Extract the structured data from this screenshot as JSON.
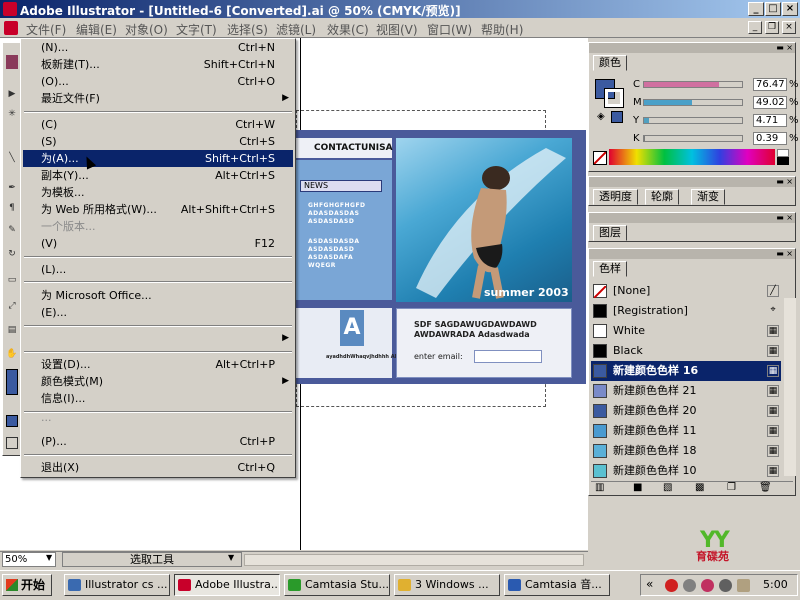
{
  "window": {
    "title": "Adobe Illustrator - [Untitled-6 [Converted].ai @ 50% (CMYK/预览)]",
    "controls": {
      "minimize": "_",
      "maximize": "□",
      "close": "×"
    }
  },
  "menubar": {
    "items": [
      "文件(F)",
      "编辑(E)",
      "对象(O)",
      "文字(T)",
      "选择(S)",
      "滤镜(L)",
      "效果(C)",
      "视图(V)",
      "窗口(W)",
      "帮助(H)"
    ],
    "doc_controls": {
      "minimize": "_",
      "restore": "❐",
      "close": "×"
    }
  },
  "file_menu": {
    "items": [
      {
        "label": "(N)...",
        "shortcut": "Ctrl+N"
      },
      {
        "label": "板新建(T)...",
        "shortcut": "Shift+Ctrl+N"
      },
      {
        "label": "(O)...",
        "shortcut": "Ctrl+O"
      },
      {
        "label": "最近文件(F)",
        "shortcut": "",
        "submenu": "▶"
      },
      {
        "label": "(C)",
        "shortcut": "Ctrl+W"
      },
      {
        "label": "(S)",
        "shortcut": "Ctrl+S"
      },
      {
        "label": "为(A)...",
        "shortcut": "Shift+Ctrl+S"
      },
      {
        "label": "副本(Y)...",
        "shortcut": "Alt+Ctrl+S"
      },
      {
        "label": "为模板...",
        "shortcut": ""
      },
      {
        "label": "为 Web 所用格式(W)...",
        "shortcut": "Alt+Shift+Ctrl+S"
      },
      {
        "label": "一个版本...",
        "shortcut": ""
      },
      {
        "label": "(V)",
        "shortcut": "F12"
      },
      {
        "label": "(L)...",
        "shortcut": ""
      },
      {
        "label": "为 Microsoft Office...",
        "shortcut": ""
      },
      {
        "label": "(E)...",
        "shortcut": ""
      },
      {
        "label": "",
        "shortcut": "",
        "submenu": "▶"
      },
      {
        "label": "设置(D)...",
        "shortcut": "Alt+Ctrl+P"
      },
      {
        "label": "颜色模式(M)",
        "shortcut": "",
        "submenu": "▶"
      },
      {
        "label": "信息(I)...",
        "shortcut": ""
      },
      {
        "label": "...",
        "shortcut": ""
      },
      {
        "label": "(P)...",
        "shortcut": "Ctrl+P"
      },
      {
        "label": "退出(X)",
        "shortcut": "Ctrl+Q"
      }
    ]
  },
  "artwork": {
    "contact": "CONTACTUNISA",
    "news": "NEWS",
    "text_block_1": [
      "GHFGHGFHGFD",
      "ADASDASDAS",
      "ASDASDASD"
    ],
    "text_block_2": [
      "ASDASDASDA",
      "ASDASDASD",
      "ASDASDAFA",
      "WQEGR"
    ],
    "summer": "summer 2003",
    "big_letter": "A",
    "tiny_text": "ayadhdhWhaqvjhdhhh Aldsdsdgwl",
    "headline": [
      "SDF SAGDAWUGDAWDAWD",
      "AWDAWRADA Adasdwada"
    ],
    "email_label": "enter email:"
  },
  "color_panel": {
    "tab": "颜色",
    "sliders": [
      {
        "letter": "C",
        "value": "76.47",
        "unit": "%",
        "level": 76.47,
        "color": "#d070a0"
      },
      {
        "letter": "M",
        "value": "49.02",
        "unit": "%",
        "level": 49.02,
        "color": "#4aa0c8"
      },
      {
        "letter": "Y",
        "value": "4.71",
        "unit": "%",
        "level": 4.71,
        "color": "#50a0c0"
      },
      {
        "letter": "K",
        "value": "0.39",
        "unit": "%",
        "level": 0.39,
        "color": "#7a7a7a"
      }
    ],
    "fill_color": "#3b5aa0"
  },
  "transparency_panel": {
    "tabs": [
      "透明度",
      "轮廓",
      "渐变"
    ]
  },
  "layers_panel": {
    "tab": "图层"
  },
  "swatches_panel": {
    "tab": "色样",
    "swatches": [
      {
        "name": "[None]",
        "color": "#ffffff"
      },
      {
        "name": "[Registration]",
        "color": "#000000"
      },
      {
        "name": "White",
        "color": "#ffffff"
      },
      {
        "name": "Black",
        "color": "#000000"
      },
      {
        "name": "新建颜色色样 16",
        "color": "#3b5aa0"
      },
      {
        "name": "新建颜色色样 21",
        "color": "#7a8ac8"
      },
      {
        "name": "新建颜色色样 20",
        "color": "#3b5aa0"
      },
      {
        "name": "新建颜色色样 11",
        "color": "#4a9ad0"
      },
      {
        "name": "新建颜色色样 18",
        "color": "#5ab0d8"
      },
      {
        "name": "新建颜色色样 10",
        "color": "#5ac0d0"
      }
    ]
  },
  "statusbar": {
    "zoom": "50%",
    "mode": "选取工具"
  },
  "logo": {
    "letters": "YY",
    "text": "育碟苑"
  },
  "taskbar": {
    "start": "开始",
    "tasks": [
      {
        "label": "Illustrator cs ...",
        "color": "#3a6ab0"
      },
      {
        "label": "Adobe Illustra...",
        "color": "#c8002a"
      },
      {
        "label": "Camtasia Stu...",
        "color": "#2a9a2a"
      },
      {
        "label": "3 Windows ...",
        "color": "#e0b030"
      },
      {
        "label": "Camtasia 音...",
        "color": "#2a5ab0"
      }
    ],
    "clock": "5:00"
  }
}
